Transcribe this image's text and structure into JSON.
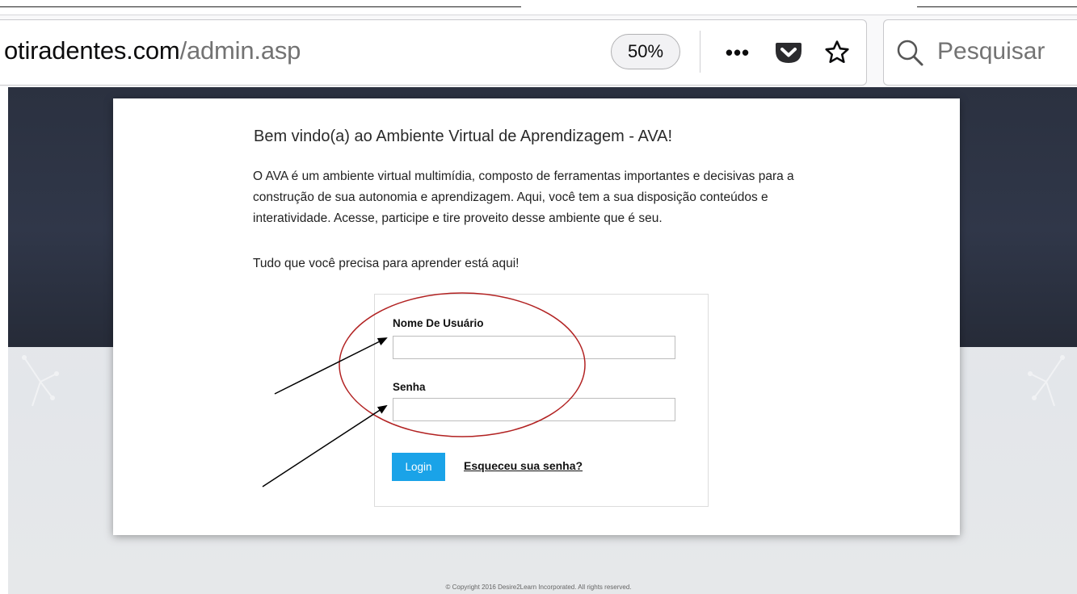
{
  "browser": {
    "url_host": "otiradentes.com",
    "url_path": "/admin.asp",
    "zoom": "50%",
    "menu_glyph": "•••",
    "search_placeholder": "Pesquisar"
  },
  "page": {
    "title": "Bem vindo(a) ao Ambiente Virtual de Aprendizagem - AVA!",
    "intro": "O AVA é um ambiente virtual multimídia, composto de ferramentas importantes e decisivas para a construção de sua autonomia e aprendizagem. Aqui, você tem a sua disposição conteúdos e interatividade. Acesse, participe e tire proveito desse ambiente que é seu.",
    "tagline": "Tudo que você precisa para aprender está aqui!",
    "login": {
      "username_label": "Nome De Usuário",
      "username_value": "",
      "password_label": "Senha",
      "password_value": "",
      "login_button": "Login",
      "forgot_link": "Esqueceu sua senha?"
    },
    "copyright": "© Copyright 2016 Desire2Learn Incorporated. All rights reserved."
  }
}
